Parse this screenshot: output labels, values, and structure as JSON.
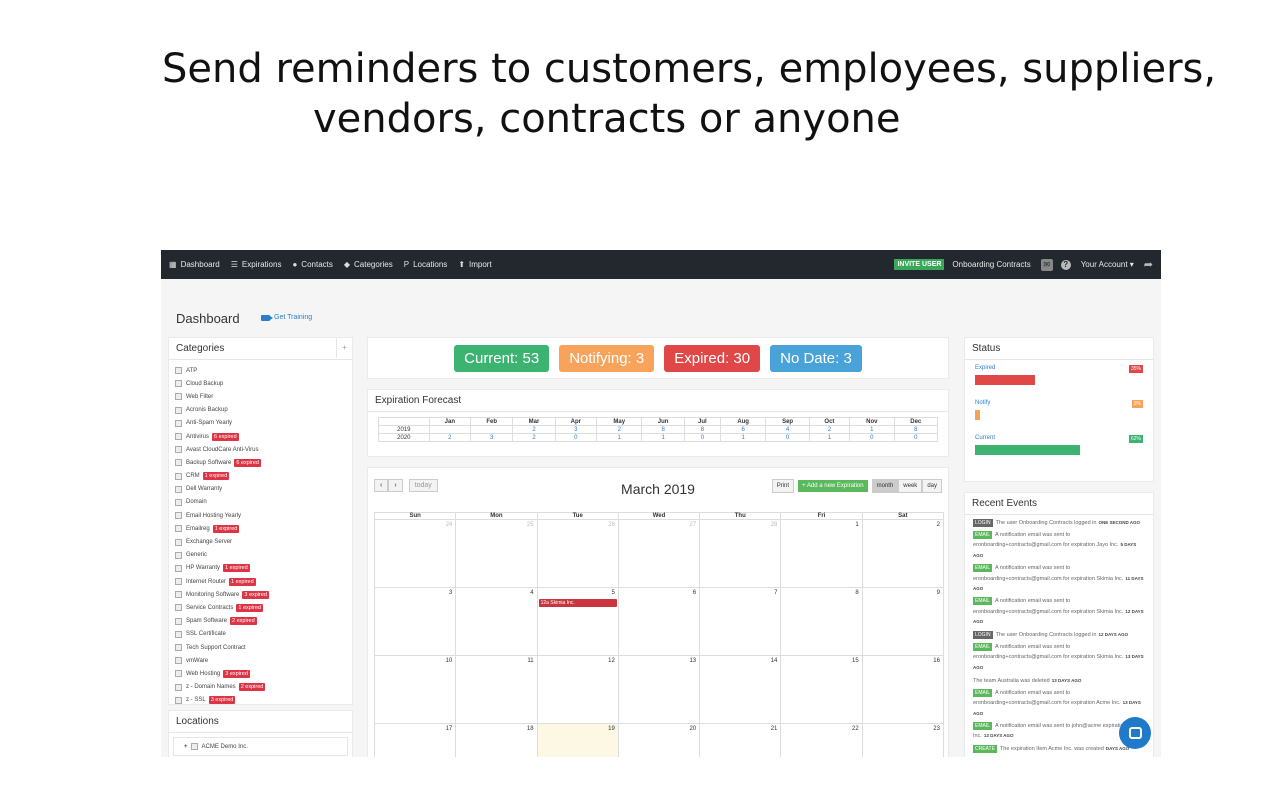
{
  "headline": {
    "line1": "Send reminders to customers, employees, suppliers,",
    "line2": "vendors, contracts or anyone"
  },
  "navbar": {
    "items": [
      {
        "label": "Dashboard",
        "icon": "calendar-icon"
      },
      {
        "label": "Expirations",
        "icon": "list-icon"
      },
      {
        "label": "Contacts",
        "icon": "users-icon"
      },
      {
        "label": "Categories",
        "icon": "tag-icon"
      },
      {
        "label": "Locations",
        "icon": "pin-icon"
      },
      {
        "label": "Import",
        "icon": "upload-icon"
      }
    ],
    "invite": "INVITE USER",
    "org": "Onboarding Contracts",
    "account": "Your Account ▾"
  },
  "page": {
    "title": "Dashboard",
    "training": "Get Training"
  },
  "categories": {
    "title": "Categories",
    "items": [
      {
        "name": "ATP",
        "badge": ""
      },
      {
        "name": "Cloud Backup",
        "badge": ""
      },
      {
        "name": "Web Filter",
        "badge": ""
      },
      {
        "name": "Acronis Backup",
        "badge": ""
      },
      {
        "name": "Anti-Spam Yearly",
        "badge": ""
      },
      {
        "name": "Antivirus",
        "badge": "6 expired"
      },
      {
        "name": "Avast CloudCare Anti-Virus",
        "badge": ""
      },
      {
        "name": "Backup Software",
        "badge": "6 expired"
      },
      {
        "name": "CRM",
        "badge": "1 expired"
      },
      {
        "name": "Dell Warranty",
        "badge": ""
      },
      {
        "name": "Domain",
        "badge": ""
      },
      {
        "name": "Email Hosting Yearly",
        "badge": ""
      },
      {
        "name": "Emailreg",
        "badge": "1 expired"
      },
      {
        "name": "Exchange Server",
        "badge": ""
      },
      {
        "name": "Generic",
        "badge": ""
      },
      {
        "name": "HP Warranty",
        "badge": "1 expired"
      },
      {
        "name": "Internet Router",
        "badge": "1 expired"
      },
      {
        "name": "Monitoring Software",
        "badge": "3 expired"
      },
      {
        "name": "Service Contracts",
        "badge": "1 expired"
      },
      {
        "name": "Spam Software",
        "badge": "2 expired"
      },
      {
        "name": "SSL Certificate",
        "badge": ""
      },
      {
        "name": "Tech Support Contract",
        "badge": ""
      },
      {
        "name": "vmWare",
        "badge": ""
      },
      {
        "name": "Web Hosting",
        "badge": "3 expired"
      },
      {
        "name": "z - Domain Names",
        "badge": "2 expired"
      },
      {
        "name": "z - SSL",
        "badge": "3 expired"
      }
    ]
  },
  "locations": {
    "title": "Locations",
    "items": [
      "ACME Demo Inc."
    ]
  },
  "counts": {
    "current": "Current: 53",
    "notifying": "Notifying: 3",
    "expired": "Expired: 30",
    "nodate": "No Date: 3"
  },
  "forecast": {
    "title": "Expiration Forecast",
    "months": [
      "Jan",
      "Feb",
      "Mar",
      "Apr",
      "May",
      "Jun",
      "Jul",
      "Aug",
      "Sep",
      "Oct",
      "Nov",
      "Dec"
    ],
    "rows": [
      {
        "year": "2019",
        "values": [
          "",
          "",
          "2",
          "3",
          "2",
          "8",
          "8",
          "6",
          "4",
          "2",
          "1",
          "8"
        ]
      },
      {
        "year": "2020",
        "values": [
          "2",
          "3",
          "2",
          "0",
          "1",
          "1",
          "0",
          "1",
          "0",
          "1",
          "0",
          "0"
        ]
      }
    ]
  },
  "calendar": {
    "title": "March 2019",
    "today_btn": "today",
    "print_btn": "Print",
    "add_btn": "+ Add a new Expiration",
    "views": [
      "month",
      "week",
      "day"
    ],
    "dow": [
      "Sun",
      "Mon",
      "Tue",
      "Wed",
      "Thu",
      "Fri",
      "Sat"
    ],
    "weeks": [
      [
        {
          "d": "24",
          "o": true
        },
        {
          "d": "25",
          "o": true
        },
        {
          "d": "26",
          "o": true
        },
        {
          "d": "27",
          "o": true
        },
        {
          "d": "28",
          "o": true
        },
        {
          "d": "1"
        },
        {
          "d": "2"
        }
      ],
      [
        {
          "d": "3"
        },
        {
          "d": "4"
        },
        {
          "d": "5",
          "ev": "12a Skimia Inc."
        },
        {
          "d": "6"
        },
        {
          "d": "7"
        },
        {
          "d": "8"
        },
        {
          "d": "9"
        }
      ],
      [
        {
          "d": "10"
        },
        {
          "d": "11"
        },
        {
          "d": "12"
        },
        {
          "d": "13"
        },
        {
          "d": "14"
        },
        {
          "d": "15"
        },
        {
          "d": "16"
        }
      ],
      [
        {
          "d": "17"
        },
        {
          "d": "18"
        },
        {
          "d": "19",
          "t": true
        },
        {
          "d": "20"
        },
        {
          "d": "21"
        },
        {
          "d": "22"
        },
        {
          "d": "23"
        }
      ]
    ]
  },
  "status": {
    "title": "Status",
    "rows": [
      {
        "label": "Expired",
        "pct": "35%",
        "value": 0.35,
        "color": "#e04848"
      },
      {
        "label": "Notify",
        "pct": "3%",
        "value": 0.03,
        "color": "#f7a35c"
      },
      {
        "label": "Current",
        "pct": "62%",
        "value": 0.62,
        "color": "#3cb371"
      }
    ]
  },
  "events": {
    "title": "Recent Events",
    "items": [
      {
        "tag": "LOGIN",
        "type": "login",
        "text": "The user Onboarding Contracts logged in",
        "time": "ONE SECOND AGO"
      },
      {
        "tag": "EMAIL",
        "type": "email",
        "text": "A notification email was sent to eronboarding+contracts@gmail.com for expiration Jayo Inc.",
        "time": "5 DAYS AGO"
      },
      {
        "tag": "EMAIL",
        "type": "email",
        "text": "A notification email was sent to eronboarding+contracts@gmail.com for expiration Skimia Inc.",
        "time": "11 DAYS AGO"
      },
      {
        "tag": "EMAIL",
        "type": "email",
        "text": "A notification email was sent to eronboarding+contracts@gmail.com for expiration Skimia Inc.",
        "time": "12 DAYS AGO"
      },
      {
        "tag": "LOGIN",
        "type": "login",
        "text": "The user Onboarding Contracts logged in",
        "time": "12 DAYS AGO"
      },
      {
        "tag": "EMAIL",
        "type": "email",
        "text": "A notification email was sent to eronboarding+contracts@gmail.com for expiration Skimia Inc.",
        "time": "13 DAYS AGO"
      },
      {
        "tag": "",
        "type": "none",
        "text": "The team Australia was deleted",
        "time": "13 DAYS AGO"
      },
      {
        "tag": "EMAIL",
        "type": "email",
        "text": "A notification email was sent to eronboarding+contracts@gmail.com for expiration Acme Inc.",
        "time": "13 DAYS AGO"
      },
      {
        "tag": "EMAIL",
        "type": "email",
        "text": "A notification email was sent to john@acme expiration Acme Inc.",
        "time": "13 DAYS AGO"
      },
      {
        "tag": "CREATE",
        "type": "create",
        "text": "The expiration Item Acme Inc. was created",
        "time": "DAYS AGO"
      }
    ]
  }
}
